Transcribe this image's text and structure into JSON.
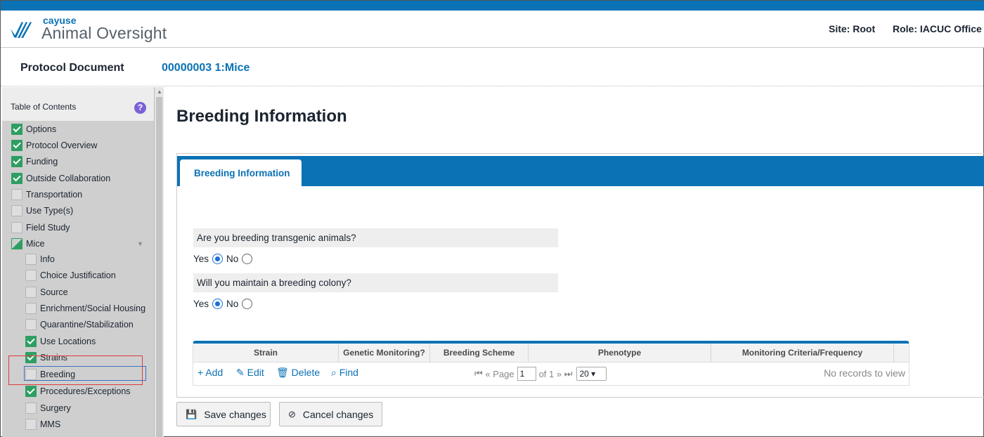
{
  "brand": {
    "small": "cayuse",
    "name": "Animal Oversight"
  },
  "header": {
    "site": "Site: Root",
    "role": "Role: IACUC Office"
  },
  "document": {
    "label": "Protocol Document",
    "link": "00000003 1:Mice"
  },
  "toc": {
    "title": "Table of Contents",
    "items": [
      {
        "label": "Options",
        "state": "checked"
      },
      {
        "label": "Protocol Overview",
        "state": "checked"
      },
      {
        "label": "Funding",
        "state": "checked"
      },
      {
        "label": "Outside Collaboration",
        "state": "checked"
      },
      {
        "label": "Transportation",
        "state": "unchecked"
      },
      {
        "label": "Use Type(s)",
        "state": "unchecked"
      },
      {
        "label": "Field Study",
        "state": "unchecked"
      },
      {
        "label": "Mice",
        "state": "partial"
      },
      {
        "label": "Info",
        "state": "unchecked"
      },
      {
        "label": "Choice Justification",
        "state": "unchecked"
      },
      {
        "label": "Source",
        "state": "unchecked"
      },
      {
        "label": "Enrichment/Social Housing",
        "state": "unchecked"
      },
      {
        "label": "Quarantine/Stabilization",
        "state": "unchecked"
      },
      {
        "label": "Use Locations",
        "state": "checked"
      },
      {
        "label": "Strains",
        "state": "checked"
      },
      {
        "label": "Breeding",
        "state": "unchecked"
      },
      {
        "label": "Procedures/Exceptions",
        "state": "checked"
      },
      {
        "label": "Surgery",
        "state": "unchecked"
      },
      {
        "label": "MMS",
        "state": "unchecked"
      }
    ]
  },
  "main": {
    "title": "Breeding Information",
    "tab": "Breeding Information",
    "questions": [
      {
        "text": "Are you breeding transgenic animals?",
        "yes": "Yes",
        "no": "No",
        "selected": "Yes"
      },
      {
        "text": "Will you maintain a breeding colony?",
        "yes": "Yes",
        "no": "No",
        "selected": "Yes"
      }
    ]
  },
  "grid": {
    "columns": [
      "Strain",
      "Genetic Monitoring?",
      "Breeding Scheme",
      "Phenotype",
      "Monitoring Criteria/Frequency"
    ],
    "add": "+ Add",
    "edit": "Edit",
    "delete": "Delete",
    "find": "Find",
    "page_label": "Page",
    "page_value": "1",
    "of_label": "of 1",
    "page_size": "20",
    "empty": "No records to view"
  },
  "buttons": {
    "save": "Save changes",
    "cancel": "Cancel changes"
  },
  "colors": {
    "accent": "#0b72b5",
    "checked": "#2f9e62",
    "radio": "#1a6fd6"
  }
}
